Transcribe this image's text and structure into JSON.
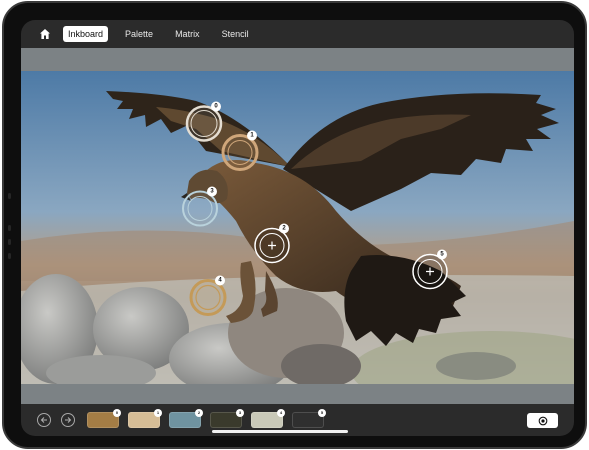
{
  "app": {
    "tabs": [
      {
        "label": "Inkboard",
        "active": true
      },
      {
        "label": "Palette",
        "active": false
      },
      {
        "label": "Matrix",
        "active": false
      },
      {
        "label": "Stencil",
        "active": false
      }
    ],
    "home_icon": "home-icon"
  },
  "canvas": {
    "subject": "eagle photograph",
    "markers": [
      {
        "id": "0",
        "ring_color": "#e4ddd2",
        "has_crosshair": false
      },
      {
        "id": "1",
        "ring_color": "#cfa67a",
        "has_crosshair": false
      },
      {
        "id": "2",
        "ring_color": "#ffffff",
        "has_crosshair": true
      },
      {
        "id": "3",
        "ring_color": "#b9d2dc",
        "has_crosshair": false
      },
      {
        "id": "4",
        "ring_color": "#c49a58",
        "has_crosshair": false
      },
      {
        "id": "5",
        "ring_color": "#ffffff",
        "has_crosshair": true
      }
    ]
  },
  "bottombar": {
    "back_icon": "arrow-left-icon",
    "forward_icon": "arrow-right-icon",
    "swatches": [
      {
        "id": "0",
        "color": "#a47d45"
      },
      {
        "id": "1",
        "color": "#d6bd96"
      },
      {
        "id": "2",
        "color": "#6f93a0"
      },
      {
        "id": "3",
        "color": "#3a3a2c"
      },
      {
        "id": "4",
        "color": "#c9c9b8"
      },
      {
        "id": "5",
        "color": "#2f2f2f"
      }
    ],
    "capture_icon": "target-icon"
  }
}
